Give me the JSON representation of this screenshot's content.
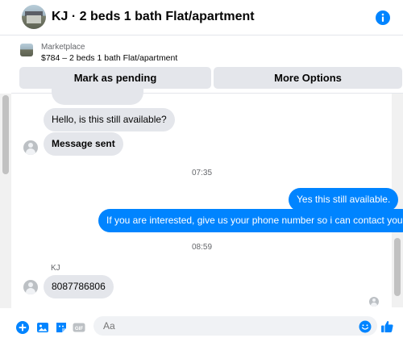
{
  "header": {
    "title": "KJ · 2 beds 1 bath Flat/apartment"
  },
  "marketplace": {
    "label": "Marketplace",
    "listing": "$784 – 2 beds 1 bath Flat/apartment",
    "pending_label": "Mark as pending",
    "more_label": "More Options"
  },
  "messages": [
    {
      "text": "Hello, is this still available?",
      "direction": "incoming"
    },
    {
      "text": "Message sent",
      "direction": "incoming"
    },
    {
      "text": "Yes this still available.",
      "direction": "outgoing"
    },
    {
      "text": "If you are interested, give us your phone number so i can contact you.",
      "direction": "outgoing"
    },
    {
      "text": "8087786806",
      "direction": "incoming"
    }
  ],
  "timestamps": [
    "07:35",
    "08:59"
  ],
  "sender_name": "KJ",
  "composer": {
    "placeholder": "Aa"
  },
  "colors": {
    "accent": "#0084ff",
    "incoming_bubble": "#e4e6eb"
  }
}
